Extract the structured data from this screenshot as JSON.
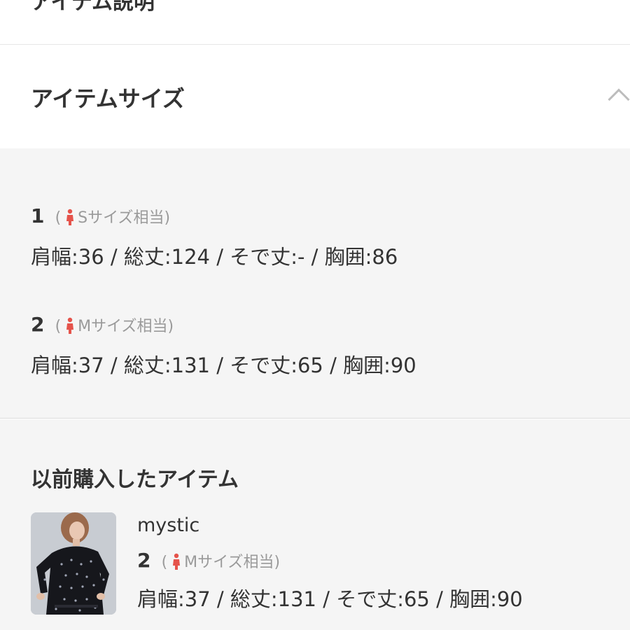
{
  "sections": {
    "description_title": "アイテム説明",
    "size_title": "アイテムサイズ"
  },
  "sizes": [
    {
      "number": "1",
      "open": "(",
      "equivalent": "Sサイズ相当",
      "close": ")",
      "dims": "肩幅:36 / 総丈:124 / そで丈:- / 胸囲:86"
    },
    {
      "number": "2",
      "open": "(",
      "equivalent": "Mサイズ相当",
      "close": ")",
      "dims": "肩幅:37 / 総丈:131 / そで丈:65 / 胸囲:90"
    }
  ],
  "history": {
    "title": "以前購入したアイテム",
    "item": {
      "brand": "mystic",
      "number": "2",
      "open": "(",
      "equivalent": "Mサイズ相当",
      "close": ")",
      "dims": "肩幅:37 / 総丈:131 / そで丈:65 / 胸囲:90"
    }
  },
  "icons": {
    "size_person": "person-icon",
    "accordion": "chevron-up-icon"
  },
  "colors": {
    "person_icon": "#e5534b",
    "panel_bg": "#f5f5f5"
  }
}
